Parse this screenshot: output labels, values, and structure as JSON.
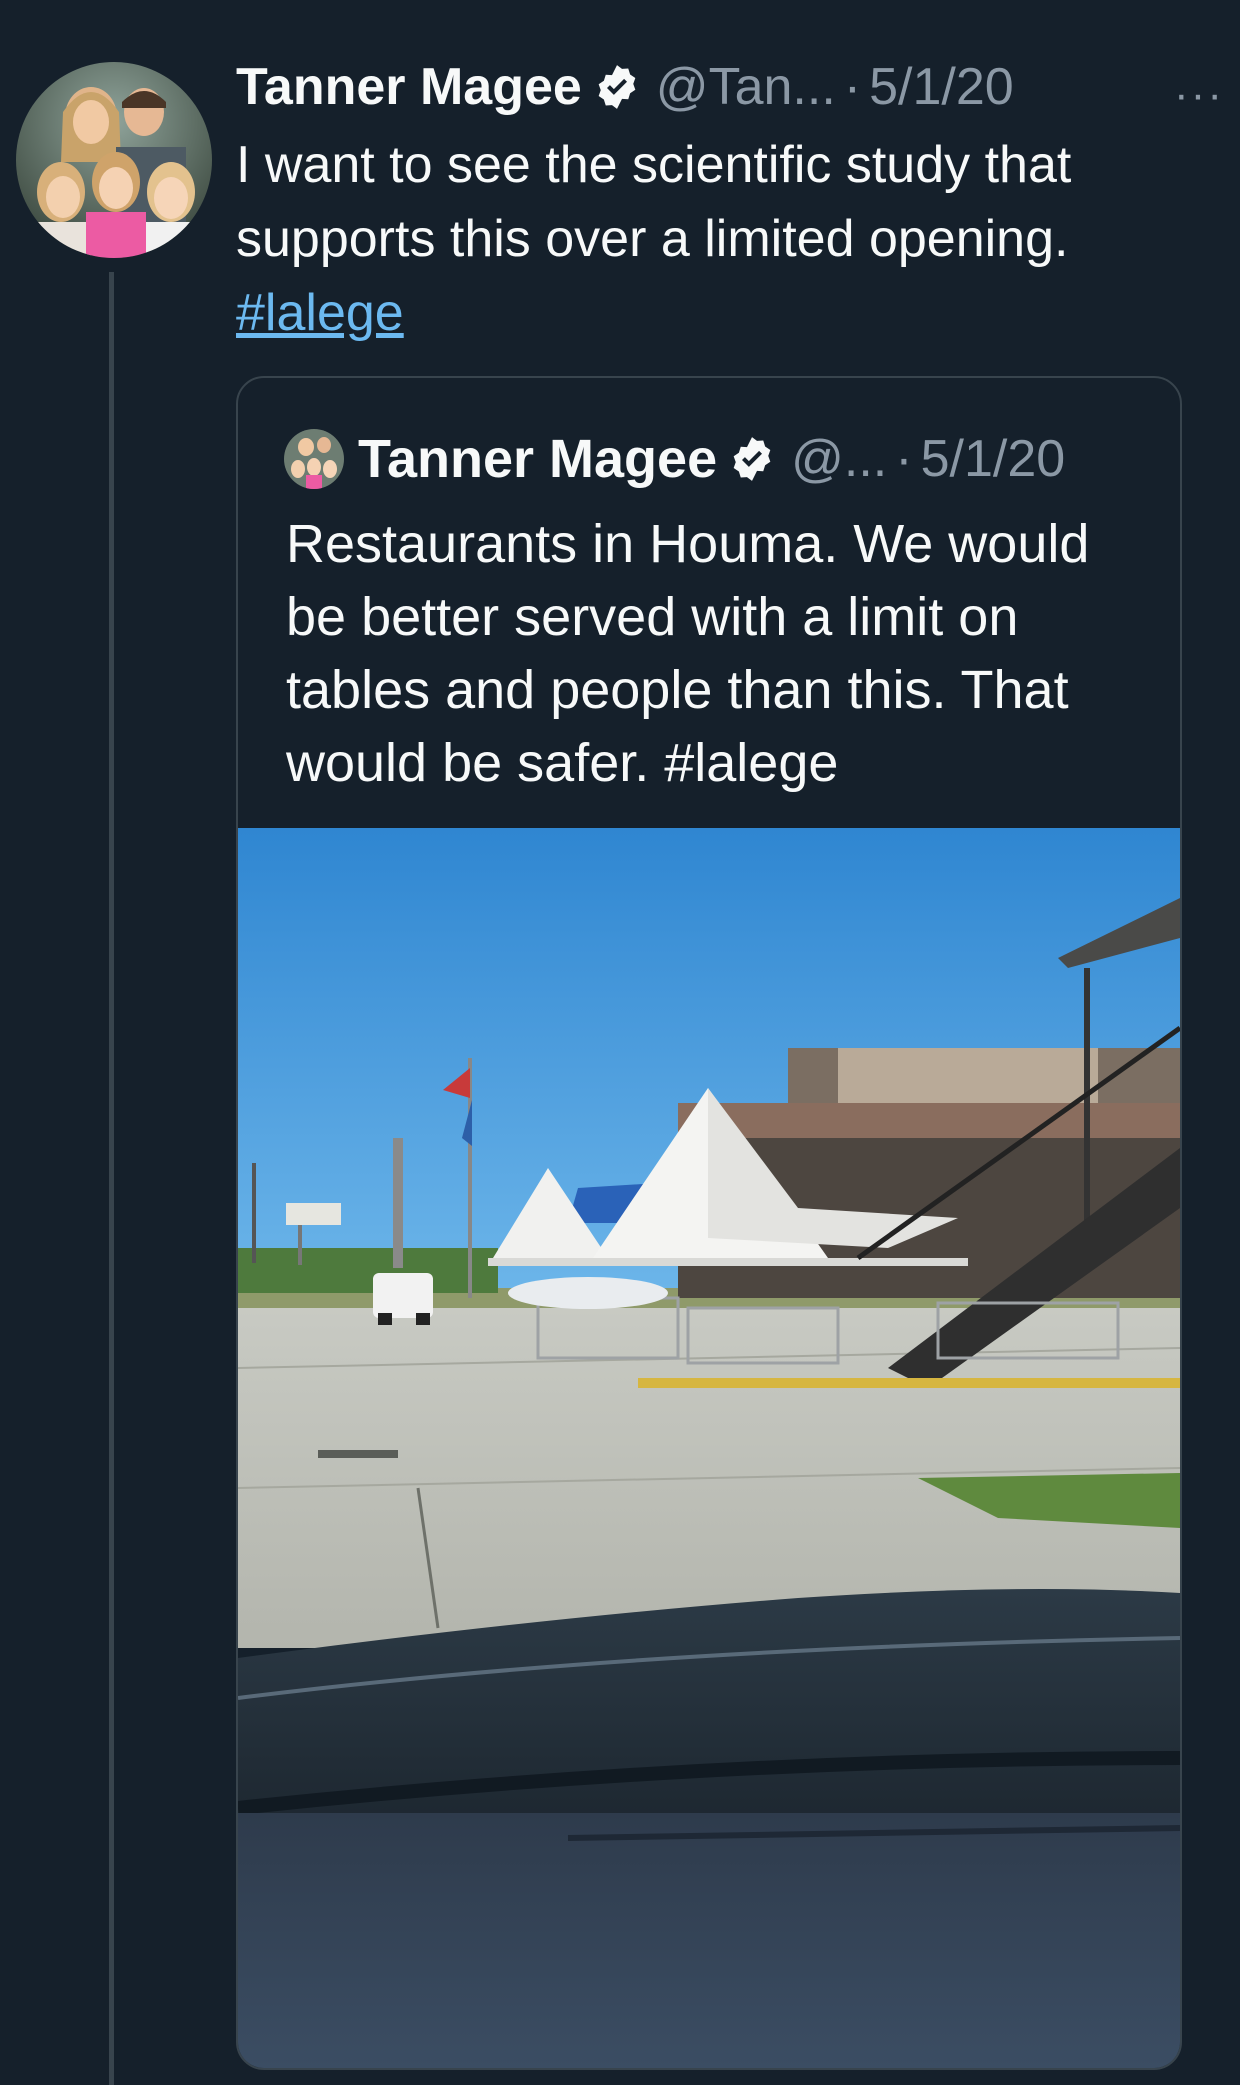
{
  "tweet": {
    "author_name": "Tanner Magee",
    "handle": "@Tan...",
    "separator": "·",
    "date": "5/1/20",
    "more_label": "···",
    "text": "I want to see the scientific study that supports this over a limited opening.",
    "hashtag": "#lalege"
  },
  "quoted_tweet": {
    "author_name": "Tanner Magee",
    "handle": "@...",
    "separator": "·",
    "date": "5/1/20",
    "text": "Restaurants in Houma. We would be better served with a limit on tables and people than this. That would be safer.",
    "hashtag": "#lalege"
  },
  "colors": {
    "background": "#15202b",
    "text": "#f7f9f9",
    "muted": "#8b98a5",
    "link": "#6cb9f0",
    "border": "#38444d"
  },
  "icons": {
    "verified": "verified-badge-icon",
    "more": "more-horizontal-icon"
  }
}
